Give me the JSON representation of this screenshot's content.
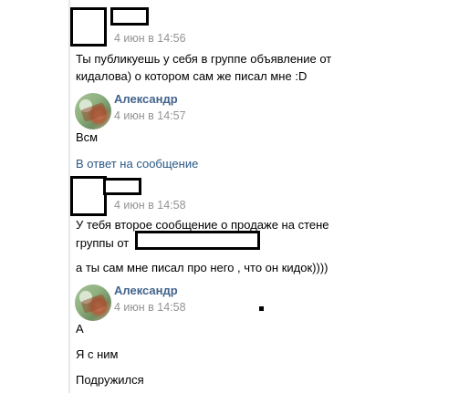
{
  "messages": [
    {
      "sender": "",
      "time": "4 июн в 14:56",
      "lines": [
        "Ты публикуешь у себя в группе объявление от",
        "кидалова) о котором сам же писал мне :D"
      ]
    },
    {
      "sender": "Александр",
      "time": "4 июн в 14:57",
      "lines": [
        "Всм"
      ]
    },
    {
      "reply_link": "В ответ на сообщение"
    },
    {
      "sender": "",
      "time": "4 июн в 14:58",
      "lines": [
        "У тебя второе сообщение о продаже на стене",
        "группы от",
        "а ты сам мне писал про него , что он кидок))))"
      ]
    },
    {
      "sender": "Александр",
      "time": "4 июн в 14:58",
      "lines": [
        "А",
        "Я с ним",
        "Подружился"
      ]
    }
  ],
  "colors": {
    "sender_name": "#42648b",
    "timestamp": "#939393",
    "link": "#2a5885"
  }
}
